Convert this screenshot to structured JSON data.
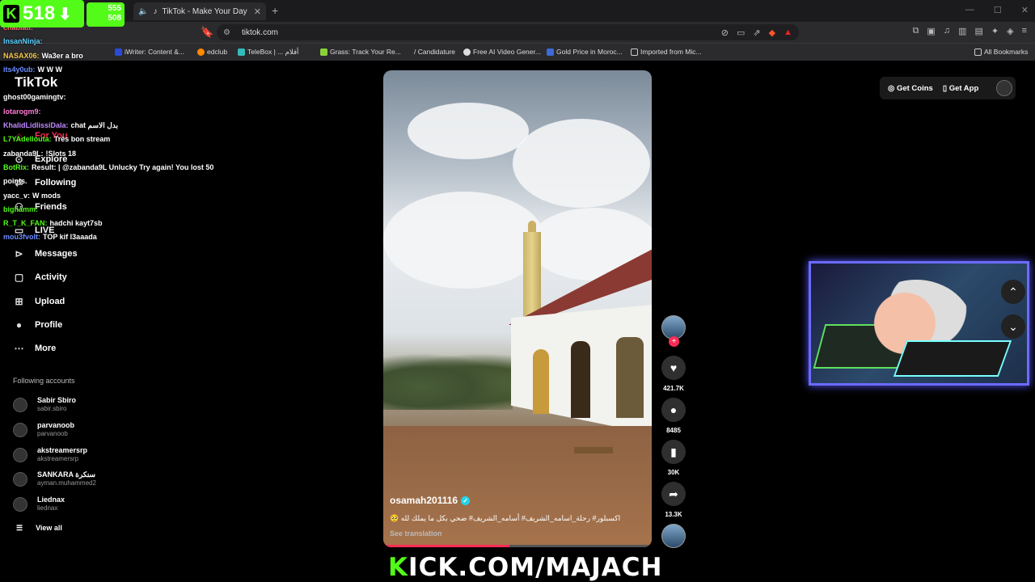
{
  "browser": {
    "tab_title": "TikTok - Make Your Day",
    "url": "tiktok.com",
    "bookmarks": [
      {
        "label": "iWriter: Content &..."
      },
      {
        "label": "edclub"
      },
      {
        "label": "TeleBox | ... أفلام"
      },
      {
        "label": "Grass: Track Your Re..."
      },
      {
        "label": "/ Candidature"
      },
      {
        "label": "Free AI Video Gener..."
      },
      {
        "label": "Gold Price in Moroc..."
      },
      {
        "label": "Imported from Mic..."
      }
    ],
    "all_bookmarks": "All Bookmarks"
  },
  "kick_overlay": {
    "viewers": "518",
    "stat_top": "555",
    "stat_bottom": "508",
    "stream_url": "ICK.COM/MAJACH",
    "stream_url_k": "K"
  },
  "chat": [
    {
      "user": "chabiati:",
      "msg": "",
      "color": "#ff6b6b"
    },
    {
      "user": "InsanNinja:",
      "msg": "",
      "color": "#5ad1ff"
    },
    {
      "user": "NASAX06:",
      "msg": "Wa3er a bro",
      "color": "#f7c948"
    },
    {
      "user": "its4y0ub:",
      "msg": "W W W",
      "color": "#6b8cff"
    },
    {
      "user": "",
      "msg": "",
      "color": "#fff"
    },
    {
      "user": "ghost00gamingtv:",
      "msg": "",
      "color": "#fff"
    },
    {
      "user": "lotarogm9:",
      "msg": "",
      "color": "#ff7bd5"
    },
    {
      "user": "KhalidLidlissiDala:",
      "msg": "chat بدل الاسم",
      "color": "#c08bff"
    },
    {
      "user": "L7YAdellouta:",
      "msg": "Très bon stream",
      "color": "#53fc18"
    },
    {
      "user": "zabanda9L:",
      "msg": "!Slots 18",
      "color": "#fff"
    },
    {
      "user": "BotRix:",
      "msg": "Result: | @zabanda9L Unlucky Try again! You lost 50",
      "color": "#53fc18"
    },
    {
      "user": "points.",
      "msg": "",
      "color": "#fff"
    },
    {
      "user": "yacc_v:",
      "msg": "W mods",
      "color": "#fff"
    },
    {
      "user": "bighamm:",
      "msg": "",
      "color": "#53fc18"
    },
    {
      "user": "R_T_K_FAN:",
      "msg": "hadchi kayt7sb",
      "color": "#53fc18"
    },
    {
      "user": "mou3fvolt:",
      "msg": "TOP kif l3aaada",
      "color": "#6b8cff"
    }
  ],
  "sidebar": {
    "logo": "TikTok",
    "nav": [
      {
        "label": "For You",
        "icon": "home-icon"
      },
      {
        "label": "Explore",
        "icon": "compass-icon"
      },
      {
        "label": "Following",
        "icon": "following-icon"
      },
      {
        "label": "Friends",
        "icon": "friends-icon"
      },
      {
        "label": "LIVE",
        "icon": "live-icon"
      },
      {
        "label": "Messages",
        "icon": "messages-icon"
      },
      {
        "label": "Activity",
        "icon": "activity-icon"
      },
      {
        "label": "Upload",
        "icon": "upload-icon"
      },
      {
        "label": "Profile",
        "icon": "profile-icon"
      },
      {
        "label": "More",
        "icon": "more-icon"
      }
    ],
    "following_header": "Following accounts",
    "accounts": [
      {
        "name": "Sabir Sbiro",
        "handle": "sabir.sbiro"
      },
      {
        "name": "parvanoob",
        "handle": "parvanoob"
      },
      {
        "name": "akstreamersrp",
        "handle": "akstreamersrp"
      },
      {
        "name": "SANKARA سنكرة",
        "handle": "ayman.muhammed2"
      },
      {
        "name": "Liednax",
        "handle": "liednax"
      }
    ],
    "view_all": "View all"
  },
  "topright": {
    "coins": "Get Coins",
    "app": "Get App"
  },
  "video": {
    "author": "osamah201116",
    "description": "اكسبلور# رحلة_اسامه_الشريف# أسامه_الشريف# ضحي بكل ما يملك لله 🥺",
    "see_translation": "See translation",
    "progress": 0.47,
    "likes": "421.7K",
    "comments": "8485",
    "saves": "30K",
    "shares": "13.3K"
  }
}
